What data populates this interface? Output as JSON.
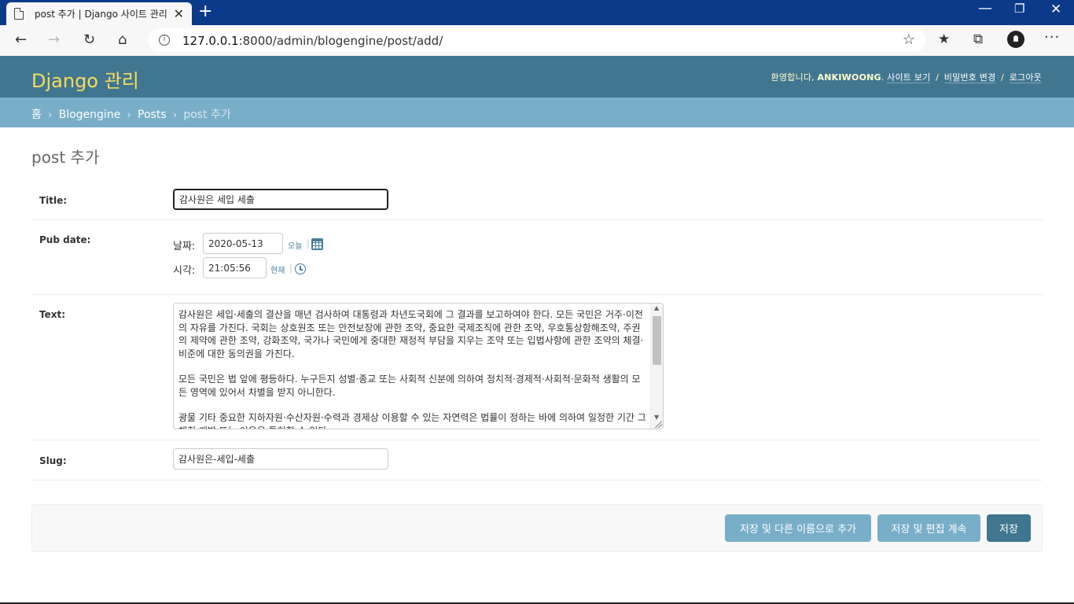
{
  "browser": {
    "tab_title": "post 추가 | Django 사이트 관리",
    "tab_close": "✕",
    "new_tab": "+",
    "url_host": "127.0.0.1",
    "url_rest": ":8000/admin/blogengine/post/add/"
  },
  "header": {
    "branding": "Django 관리",
    "welcome": "환영합니다,",
    "username": "ANKIWOONG",
    "view_site": "사이트 보기",
    "change_password": "비밀번호 변경",
    "logout": "로그아웃",
    "separator": "/"
  },
  "breadcrumbs": {
    "home": "홈",
    "app": "Blogengine",
    "model": "Posts",
    "current": "post 추가",
    "separator": "›"
  },
  "page_title": "post 추가",
  "form": {
    "title": {
      "label": "Title:",
      "value": "감사원은 세입 세출"
    },
    "pub_date": {
      "label": "Pub date:",
      "date_label": "날짜:",
      "date_value": "2020-05-13",
      "today_link": "오늘",
      "time_label": "시각:",
      "time_value": "21:05:56",
      "now_link": "현재",
      "pipe": "|"
    },
    "text": {
      "label": "Text:",
      "paragraphs": [
        "감사원은 세입·세출의 결산을 매년 검사하여 대통령과 차년도국회에 그 결과를 보고하여야 한다. 모든 국민은 거주·이전의 자유를 가진다. 국회는 상호원조 또는 안전보장에 관한 조약, 중요한 국제조직에 관한 조약, 우호통상항해조약, 주권의 제약에 관한 조약, 강화조약, 국가나 국민에게 중대한 재정적 부담을 지우는 조약 또는 입법사항에 관한 조약의 체결·비준에 대한 동의권을 가진다.",
        "모든 국민은 법 앞에 평등하다. 누구든지 성별·종교 또는 사회적 신분에 의하여 정치적·경제적·사회적·문화적 생활의 모든 영역에 있어서 차별을 받지 아니한다.",
        "광물 기타 중요한 지하자원·수산자원·수력과 경제상 이용할 수 있는 자연력은 법률이 정하는 바에 의하여 일정한 기간 그 채취·개발 또는 이용을 특허할 수 있다."
      ]
    },
    "slug": {
      "label": "Slug:",
      "value": "감사원은-세입-세출"
    }
  },
  "submit": {
    "save_as_new": "저장 및 다른 이름으로 추가",
    "save_continue": "저장 및 편집 계속",
    "save": "저장"
  },
  "colors": {
    "header_bg": "#417690",
    "breadcrumbs_bg": "#79aec8",
    "branding": "#f5dd5d",
    "button": "#79aec8",
    "default_button": "#417690"
  }
}
